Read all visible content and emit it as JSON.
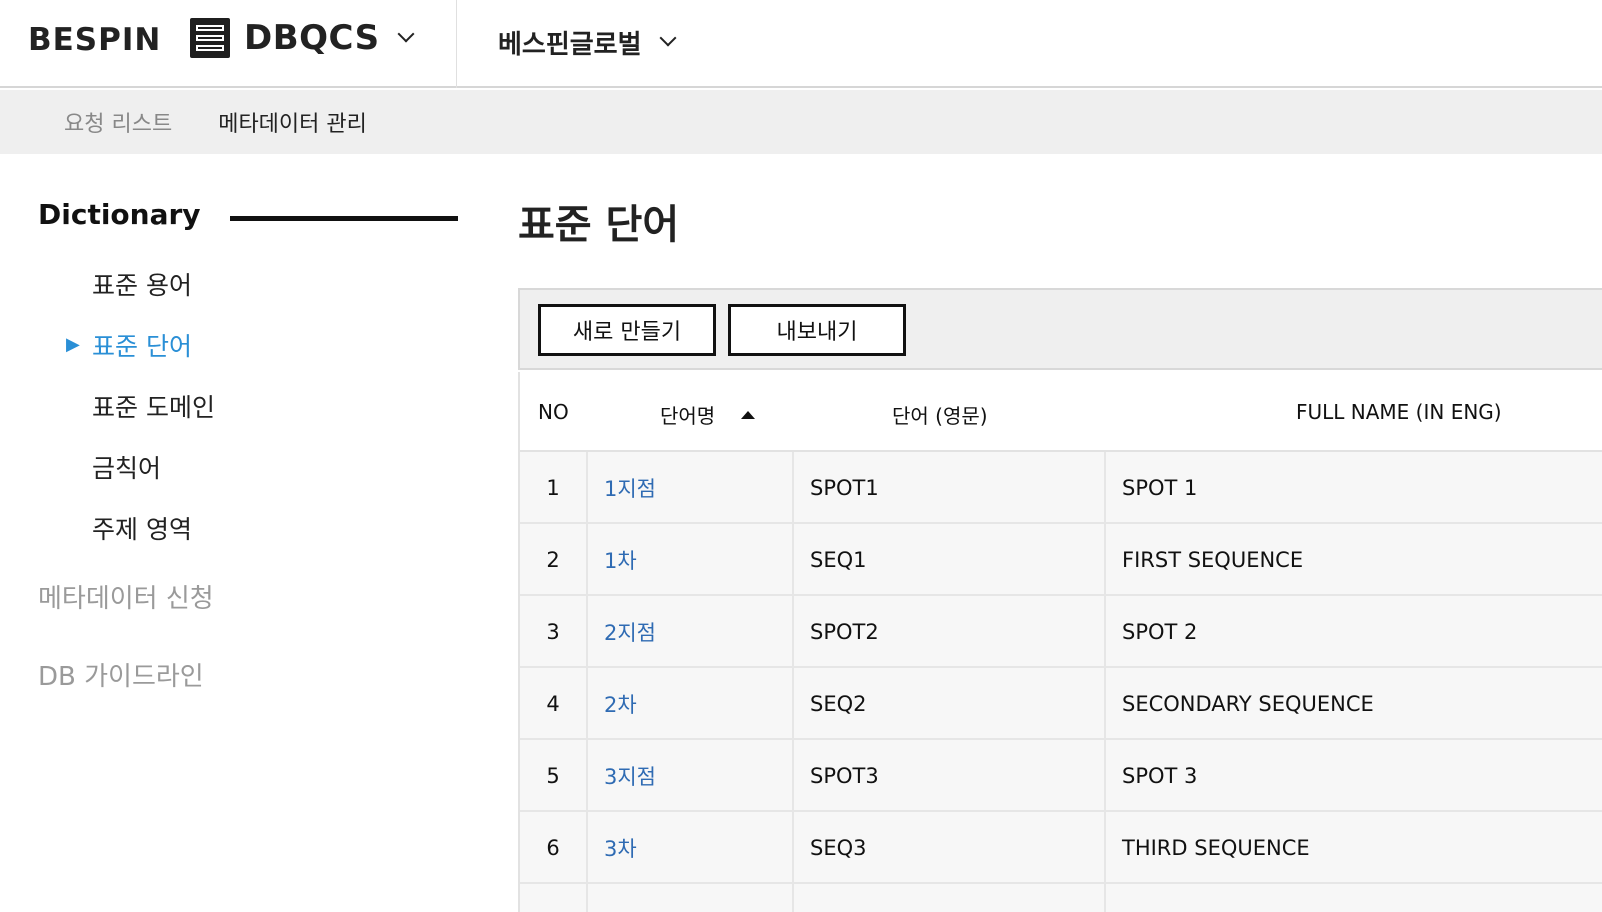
{
  "header": {
    "brand": "BESPIN",
    "app_name": "DBQCS",
    "org_name": "베스핀글로벌"
  },
  "subnav": {
    "items": [
      {
        "label": "요청 리스트",
        "active": false
      },
      {
        "label": "메타데이터 관리",
        "active": true
      }
    ]
  },
  "sidebar": {
    "section_title": "Dictionary",
    "items": [
      {
        "label": "표준 용어"
      },
      {
        "label": "표준 단어",
        "active": true
      },
      {
        "label": "표준 도메인"
      },
      {
        "label": "금칙어"
      },
      {
        "label": "주제 영역"
      }
    ],
    "active_marker": "▶",
    "groups": [
      {
        "label": "메타데이터 신청"
      },
      {
        "label": "DB 가이드라인"
      }
    ]
  },
  "main": {
    "title": "표준 단어",
    "toolbar": {
      "new_label": "새로 만들기",
      "export_label": "내보내기"
    },
    "table": {
      "columns": [
        "NO",
        "단어명",
        "단어 (영문)",
        "FULL NAME (IN ENG)"
      ],
      "sort": {
        "column": "단어명",
        "direction": "asc"
      },
      "rows": [
        {
          "no": "1",
          "name": "1지점",
          "eng": "SPOT1",
          "full": "SPOT 1"
        },
        {
          "no": "2",
          "name": "1차",
          "eng": "SEQ1",
          "full": "FIRST SEQUENCE"
        },
        {
          "no": "3",
          "name": "2지점",
          "eng": "SPOT2",
          "full": "SPOT 2"
        },
        {
          "no": "4",
          "name": "2차",
          "eng": "SEQ2",
          "full": "SECONDARY SEQUENCE"
        },
        {
          "no": "5",
          "name": "3지점",
          "eng": "SPOT3",
          "full": "SPOT 3"
        },
        {
          "no": "6",
          "name": "3차",
          "eng": "SEQ3",
          "full": "THIRD SEQUENCE"
        }
      ]
    }
  },
  "colors": {
    "accent": "#2a8fd6",
    "link": "#2f6bb3",
    "subnav_bg": "#efefef",
    "muted": "#9a9a9a"
  }
}
